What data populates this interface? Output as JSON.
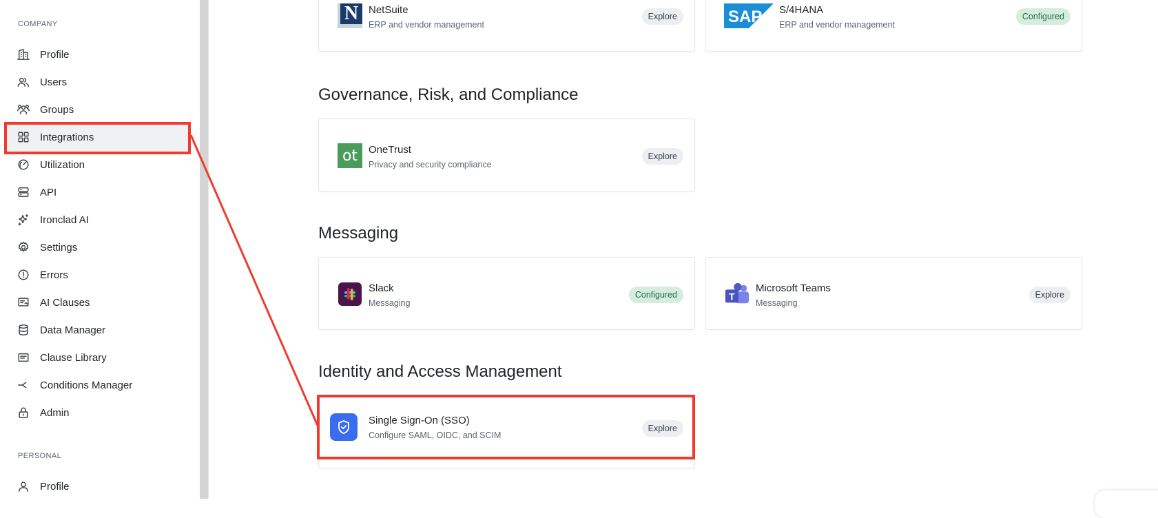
{
  "sidebar": {
    "company_label": "COMPANY",
    "personal_label": "PERSONAL",
    "items": [
      {
        "label": "Profile",
        "icon": "building-icon"
      },
      {
        "label": "Users",
        "icon": "users-icon"
      },
      {
        "label": "Groups",
        "icon": "groups-icon"
      },
      {
        "label": "Integrations",
        "icon": "grid-icon",
        "active": true
      },
      {
        "label": "Utilization",
        "icon": "gauge-icon"
      },
      {
        "label": "API",
        "icon": "server-icon"
      },
      {
        "label": "Ironclad AI",
        "icon": "sparkle-icon"
      },
      {
        "label": "Settings",
        "icon": "gear-icon"
      },
      {
        "label": "Errors",
        "icon": "alert-icon"
      },
      {
        "label": "AI Clauses",
        "icon": "clause-icon"
      },
      {
        "label": "Data Manager",
        "icon": "database-icon"
      },
      {
        "label": "Clause Library",
        "icon": "library-icon"
      },
      {
        "label": "Conditions Manager",
        "icon": "branch-icon"
      },
      {
        "label": "Admin",
        "icon": "lock-icon"
      }
    ],
    "personal_items": [
      {
        "label": "Profile",
        "icon": "user-icon"
      }
    ]
  },
  "main": {
    "sections": [
      {
        "title": "Governance, Risk, and Compliance"
      },
      {
        "title": "Messaging"
      },
      {
        "title": "Identity and Access Management"
      }
    ],
    "cards": {
      "netsuite": {
        "name": "NetSuite",
        "desc": "ERP and vendor management",
        "status": "Explore"
      },
      "sap": {
        "name": "S/4HANA",
        "desc": "ERP and vendor management",
        "status": "Configured"
      },
      "onetrust": {
        "name": "OneTrust",
        "desc": "Privacy and security compliance",
        "status": "Explore",
        "logo_text": "ot"
      },
      "slack": {
        "name": "Slack",
        "desc": "Messaging",
        "status": "Configured"
      },
      "teams": {
        "name": "Microsoft Teams",
        "desc": "Messaging",
        "status": "Explore"
      },
      "sso": {
        "name": "Single Sign-On (SSO)",
        "desc": "Configure SAML, OIDC, and SCIM",
        "status": "Explore"
      }
    },
    "logos": {
      "netsuite_text": "N",
      "sap_text": "SAP",
      "teams_text": "T"
    }
  },
  "colors": {
    "highlight": "#ef3b2d",
    "configured_bg": "#d5ecdf",
    "explore_bg": "#eceef1",
    "sso_icon": "#3b6cf0"
  }
}
